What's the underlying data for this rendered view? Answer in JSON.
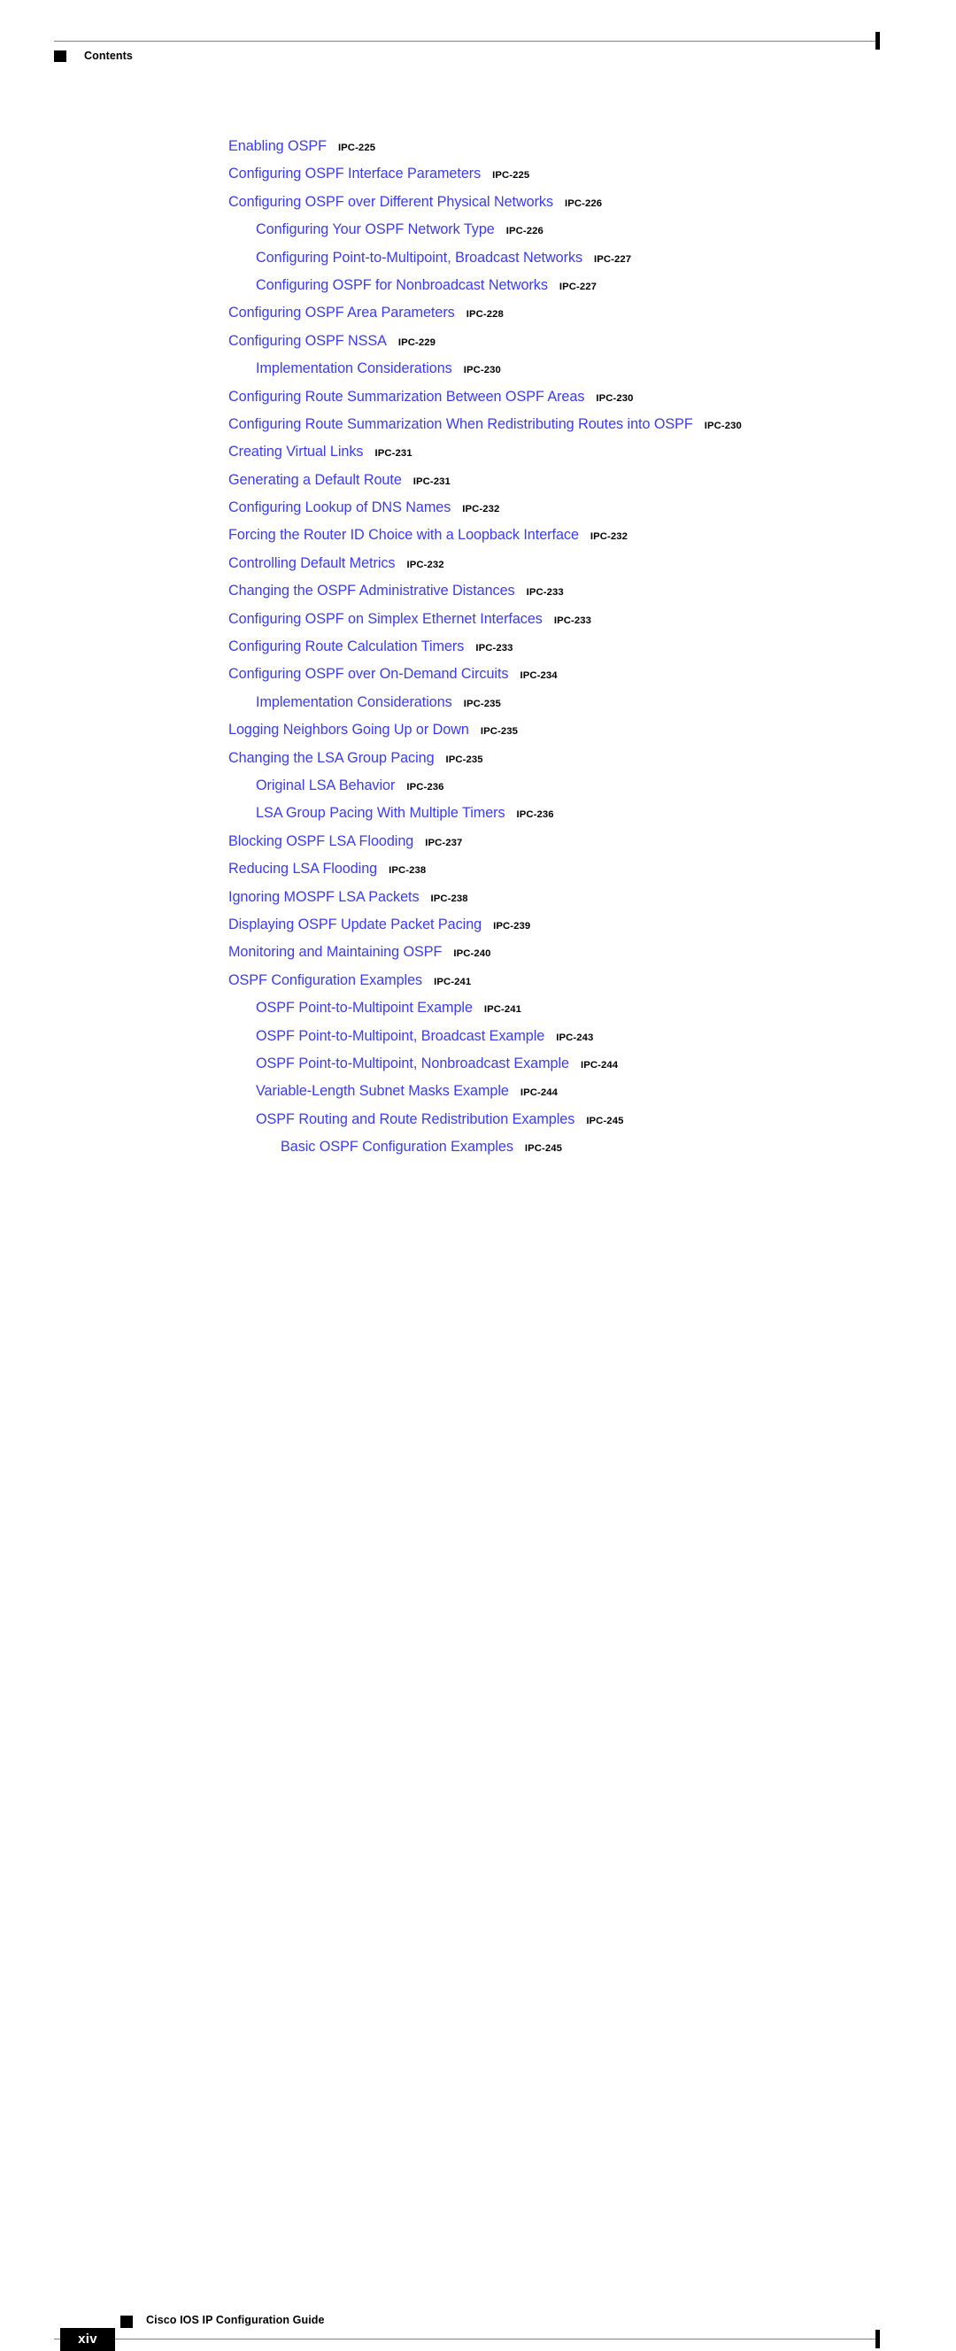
{
  "header": {
    "section_label": "Contents"
  },
  "toc": {
    "entries": [
      {
        "title": "Enabling OSPF",
        "page": "IPC-225",
        "level": 1
      },
      {
        "title": "Configuring OSPF Interface Parameters",
        "page": "IPC-225",
        "level": 1
      },
      {
        "title": "Configuring OSPF over Different Physical Networks",
        "page": "IPC-226",
        "level": 1
      },
      {
        "title": "Configuring Your OSPF Network Type",
        "page": "IPC-226",
        "level": 2
      },
      {
        "title": "Configuring Point-to-Multipoint, Broadcast Networks",
        "page": "IPC-227",
        "level": 2
      },
      {
        "title": "Configuring OSPF for Nonbroadcast Networks",
        "page": "IPC-227",
        "level": 2
      },
      {
        "title": "Configuring OSPF Area Parameters",
        "page": "IPC-228",
        "level": 1
      },
      {
        "title": "Configuring OSPF NSSA",
        "page": "IPC-229",
        "level": 1
      },
      {
        "title": "Implementation Considerations",
        "page": "IPC-230",
        "level": 2
      },
      {
        "title": "Configuring Route Summarization Between OSPF Areas",
        "page": "IPC-230",
        "level": 1
      },
      {
        "title": "Configuring Route Summarization When Redistributing Routes into OSPF",
        "page": "IPC-230",
        "level": 1
      },
      {
        "title": "Creating Virtual Links",
        "page": "IPC-231",
        "level": 1
      },
      {
        "title": "Generating a Default Route",
        "page": "IPC-231",
        "level": 1
      },
      {
        "title": "Configuring Lookup of DNS Names",
        "page": "IPC-232",
        "level": 1
      },
      {
        "title": "Forcing the Router ID Choice with a Loopback Interface",
        "page": "IPC-232",
        "level": 1
      },
      {
        "title": "Controlling Default Metrics",
        "page": "IPC-232",
        "level": 1
      },
      {
        "title": "Changing the OSPF Administrative Distances",
        "page": "IPC-233",
        "level": 1
      },
      {
        "title": "Configuring OSPF on Simplex Ethernet Interfaces",
        "page": "IPC-233",
        "level": 1
      },
      {
        "title": "Configuring Route Calculation Timers",
        "page": "IPC-233",
        "level": 1
      },
      {
        "title": "Configuring OSPF over On-Demand Circuits",
        "page": "IPC-234",
        "level": 1
      },
      {
        "title": "Implementation Considerations",
        "page": "IPC-235",
        "level": 2
      },
      {
        "title": "Logging Neighbors Going Up or Down",
        "page": "IPC-235",
        "level": 1
      },
      {
        "title": "Changing the LSA Group Pacing",
        "page": "IPC-235",
        "level": 1
      },
      {
        "title": "Original LSA Behavior",
        "page": "IPC-236",
        "level": 2
      },
      {
        "title": "LSA Group Pacing With Multiple Timers",
        "page": "IPC-236",
        "level": 2
      },
      {
        "title": "Blocking OSPF LSA Flooding",
        "page": "IPC-237",
        "level": 1
      },
      {
        "title": "Reducing LSA Flooding",
        "page": "IPC-238",
        "level": 1
      },
      {
        "title": "Ignoring MOSPF LSA Packets",
        "page": "IPC-238",
        "level": 1
      },
      {
        "title": "Displaying OSPF Update Packet Pacing",
        "page": "IPC-239",
        "level": 1
      },
      {
        "title": "Monitoring and Maintaining OSPF",
        "page": "IPC-240",
        "level": 1
      },
      {
        "title": "OSPF Configuration Examples",
        "page": "IPC-241",
        "level": 1
      },
      {
        "title": "OSPF Point-to-Multipoint Example",
        "page": "IPC-241",
        "level": 2
      },
      {
        "title": "OSPF Point-to-Multipoint, Broadcast Example",
        "page": "IPC-243",
        "level": 2
      },
      {
        "title": "OSPF Point-to-Multipoint, Nonbroadcast Example",
        "page": "IPC-244",
        "level": 2
      },
      {
        "title": "Variable-Length Subnet Masks Example",
        "page": "IPC-244",
        "level": 2
      },
      {
        "title": "OSPF Routing and Route Redistribution Examples",
        "page": "IPC-245",
        "level": 2
      },
      {
        "title": "Basic OSPF Configuration Examples",
        "page": "IPC-245",
        "level": 3
      }
    ]
  },
  "footer": {
    "page_number": "xiv",
    "document_title": "Cisco IOS IP Configuration Guide"
  },
  "colors": {
    "link_blue": "#3B3BF0",
    "text_black": "#000000",
    "rule_gray": "#808080"
  }
}
